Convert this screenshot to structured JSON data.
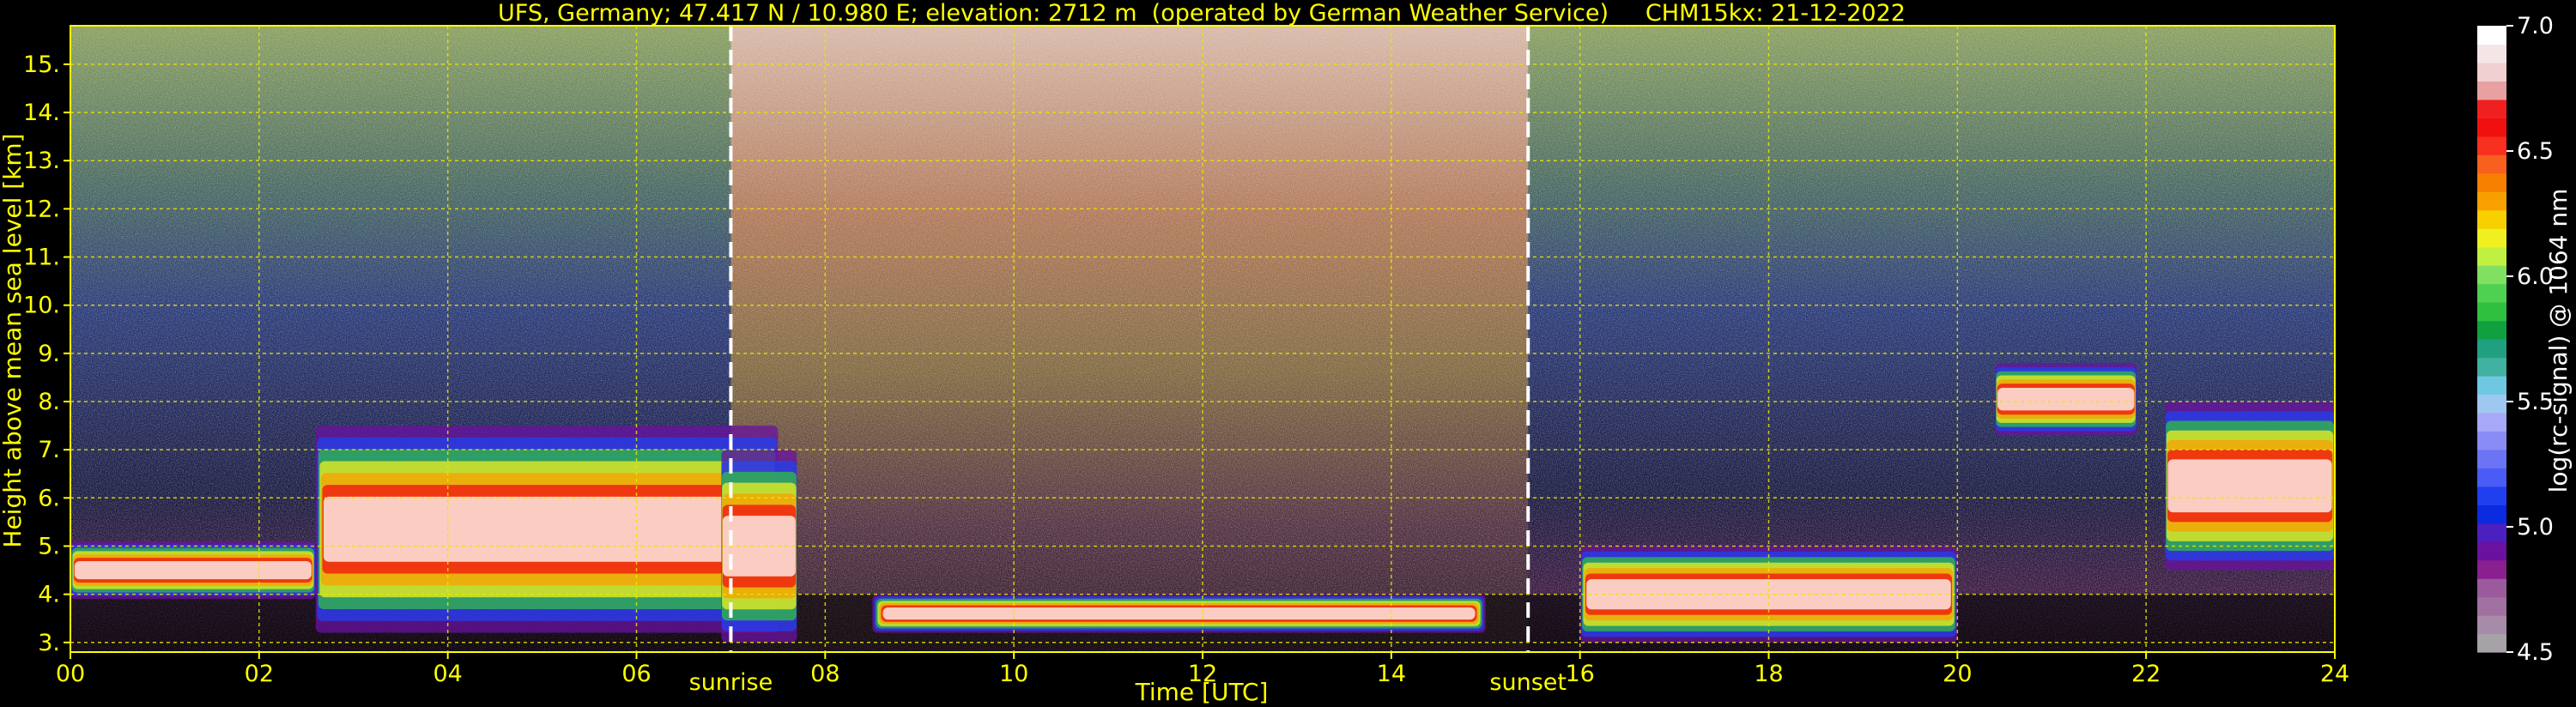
{
  "chart_data": {
    "type": "heatmap",
    "title": "UFS, Germany; 47.417 N / 10.980 E; elevation: 2712 m  (operated by German Weather Service)     CHM15kx: 21-12-2022",
    "xlabel": "Time [UTC]",
    "ylabel": "Height above mean sea level [km]",
    "xlim": [
      0,
      24
    ],
    "ylim": [
      2.8,
      15.8
    ],
    "x_ticks": [
      "00",
      "02",
      "04",
      "06",
      "08",
      "10",
      "12",
      "14",
      "16",
      "18",
      "20",
      "22",
      "24"
    ],
    "y_ticks": [
      "3.",
      "4.",
      "5.",
      "6.",
      "7.",
      "8.",
      "9.",
      "10.",
      "11.",
      "12.",
      "13.",
      "14.",
      "15."
    ],
    "grid": true,
    "markers": [
      {
        "label": "sunrise",
        "x": 7.0
      },
      {
        "label": "sunset",
        "x": 15.45
      }
    ],
    "colorbar": {
      "label": "log(rc-signal) @ 1064 nm",
      "range": [
        4.5,
        7.0
      ],
      "ticks": [
        "4.5",
        "5.0",
        "5.5",
        "6.0",
        "6.5",
        "7.0"
      ],
      "colors": [
        "#a7a1a8",
        "#a68ba8",
        "#a070a0",
        "#9a5a9c",
        "#8a1f8f",
        "#6a11a0",
        "#4a20c0",
        "#0a2be0",
        "#2040f0",
        "#4a5cf5",
        "#6a74f5",
        "#8a8cf5",
        "#a8a8f8",
        "#9ec8f0",
        "#70c8e0",
        "#40b0a0",
        "#20a080",
        "#10a040",
        "#30c040",
        "#50d050",
        "#80e060",
        "#c0f040",
        "#f0f020",
        "#f8d000",
        "#f8a000",
        "#f88000",
        "#f86020",
        "#f83020",
        "#f01010",
        "#f02020",
        "#e8a0a0",
        "#f0d0d0",
        "#f4e6e6",
        "#ffffff"
      ]
    },
    "regions": [
      {
        "type": "cloud",
        "x": [
          0.0,
          2.6
        ],
        "y": [
          3.9,
          5.1
        ],
        "note": ""
      },
      {
        "type": "cloud",
        "x": [
          2.6,
          7.5
        ],
        "y": [
          3.2,
          7.5
        ],
        "note": ""
      },
      {
        "type": "cloud",
        "x": [
          6.9,
          7.7
        ],
        "y": [
          3.0,
          7.0
        ],
        "note": ""
      },
      {
        "type": "low_layer",
        "x": [
          8.5,
          15.0
        ],
        "y": [
          3.2,
          4.0
        ],
        "note": ""
      },
      {
        "type": "cloud",
        "x": [
          16.0,
          20.0
        ],
        "y": [
          3.0,
          5.0
        ],
        "note": ""
      },
      {
        "type": "cloud",
        "x": [
          20.4,
          21.9
        ],
        "y": [
          7.3,
          8.8
        ],
        "note": ""
      },
      {
        "type": "cloud",
        "x": [
          22.2,
          24.0
        ],
        "y": [
          4.5,
          8.0
        ],
        "note": ""
      }
    ]
  }
}
